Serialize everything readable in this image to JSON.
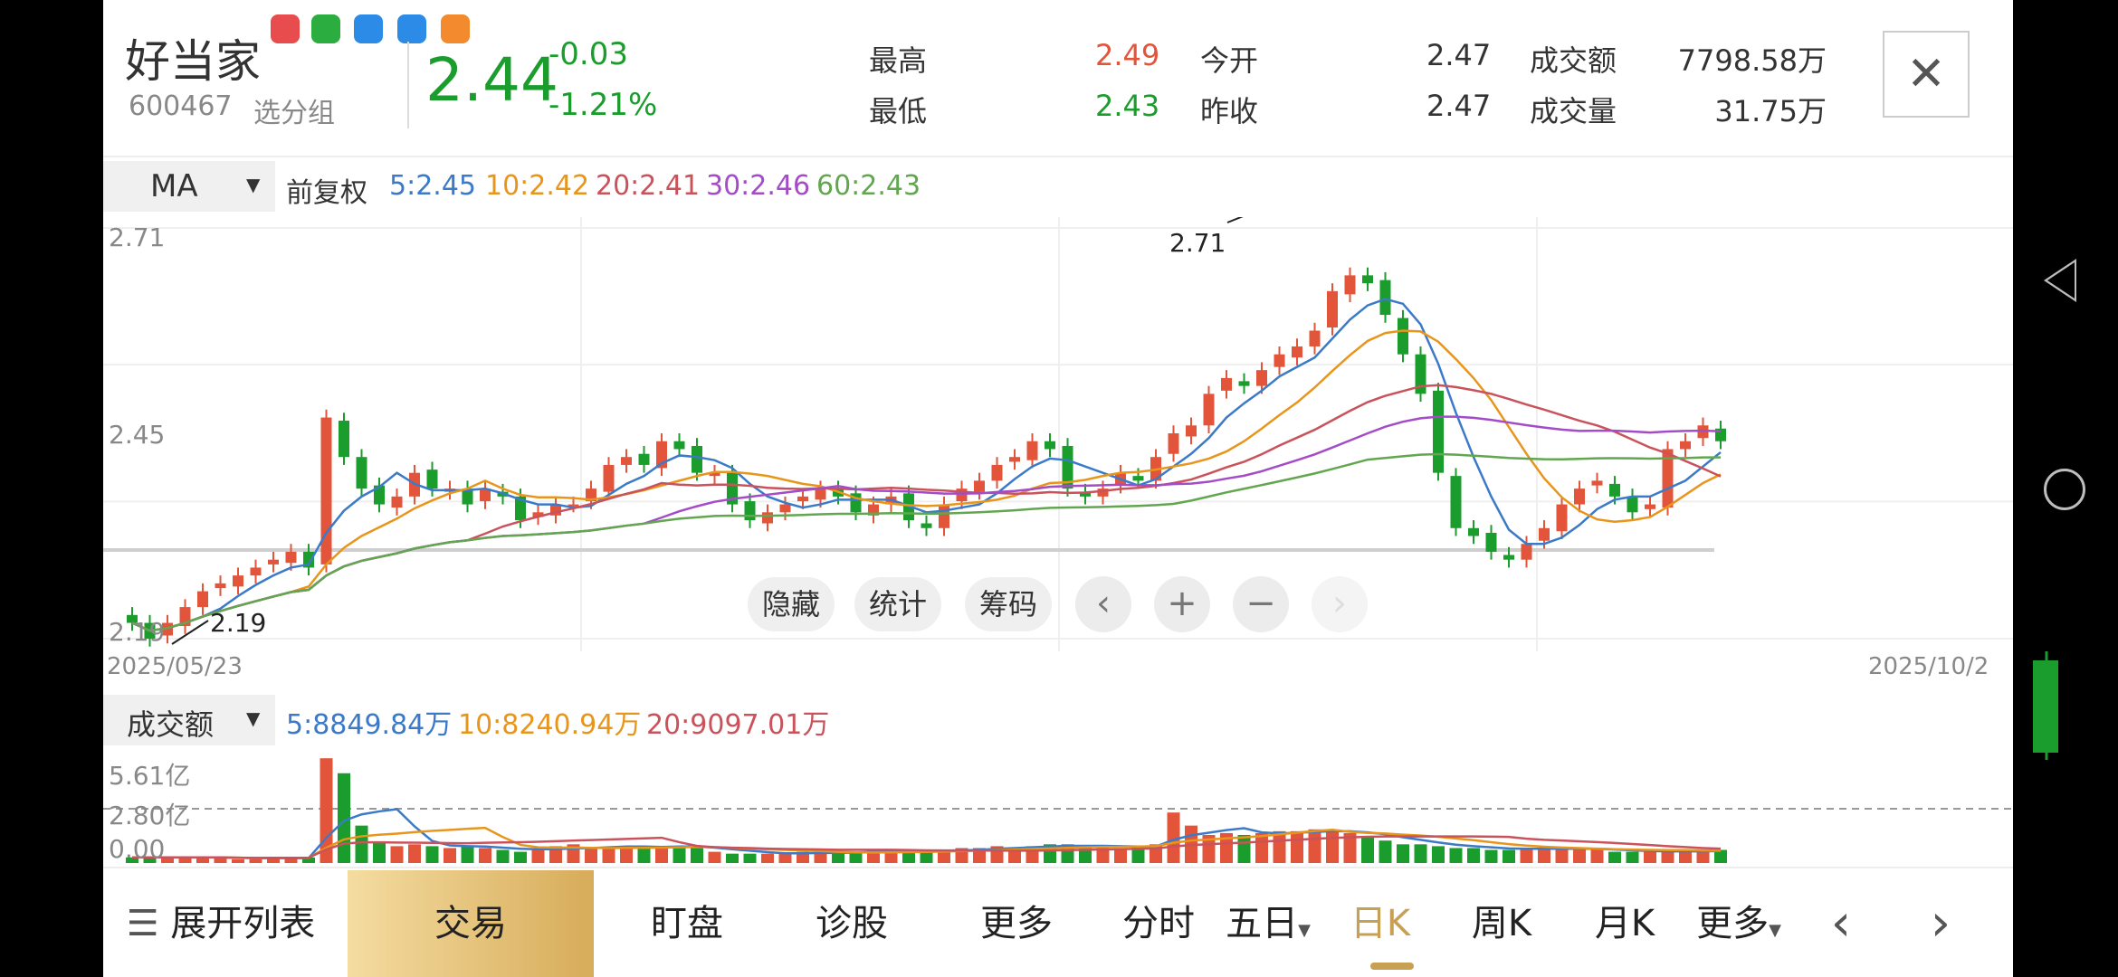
{
  "header": {
    "name": "好当家",
    "code": "600467",
    "group": "选分组",
    "price": "2.44",
    "change": "-0.03",
    "change_pct": "-1.21%",
    "high_label": "最高",
    "high": "2.49",
    "low_label": "最低",
    "low": "2.43",
    "open_label": "今开",
    "open": "2.47",
    "prev_close_label": "昨收",
    "prev_close": "2.47",
    "amount_label": "成交额",
    "amount": "7798.58万",
    "volume_label": "成交量",
    "volume": "31.75万",
    "close_symbol": "✕"
  },
  "indicator": {
    "type": "MA",
    "adjust": "前复权",
    "ma5": "5:2.45",
    "ma10": "10:2.42",
    "ma20": "20:2.41",
    "ma30": "30:2.46",
    "ma60": "60:2.43"
  },
  "chart": {
    "y_top": "2.71",
    "y_mid": "2.45",
    "y_bottom": "2.19",
    "max_annot": "2.71",
    "min_annot": "2.19",
    "date_start": "2025/05/23",
    "date_end": "2025/10/2",
    "buttons": {
      "hide": "隐藏",
      "stats": "统计",
      "chips": "筹码"
    },
    "nav": {
      "prev": "‹",
      "zoom_in": "+",
      "zoom_out": "−",
      "next": "›"
    }
  },
  "volume_panel": {
    "type": "成交额",
    "ma5": "5:8849.84万",
    "ma10": "10:8240.94万",
    "ma20": "20:9097.01万",
    "y_top": "5.61亿",
    "y_mid": "2.80亿",
    "y_bottom": "0.00"
  },
  "tabs": {
    "expand": "展开列表",
    "trade": "交易",
    "watch": "盯盘",
    "diagnose": "诊股",
    "more1": "更多",
    "intraday": "分时",
    "five_day": "五日",
    "daily": "日K",
    "weekly": "周K",
    "monthly": "月K",
    "more2": "更多",
    "left": "‹",
    "right": "›"
  },
  "colors": {
    "up": "#e2553b",
    "down": "#1a9d2c",
    "ma5": "#3b7ac9",
    "ma10": "#e8951c",
    "ma20": "#c9525b",
    "ma30": "#a44cc7",
    "ma60": "#62a650",
    "trade_tab": "#e6c16e"
  },
  "chart_data": {
    "type": "candlestick",
    "date_range": [
      "2025/05/23",
      "2025/10/2"
    ],
    "ylim": [
      2.19,
      2.71
    ],
    "close": [
      2.21,
      2.19,
      2.21,
      2.23,
      2.25,
      2.26,
      2.27,
      2.28,
      2.29,
      2.3,
      2.28,
      2.47,
      2.42,
      2.38,
      2.36,
      2.37,
      2.4,
      2.38,
      2.38,
      2.36,
      2.38,
      2.37,
      2.34,
      2.35,
      2.36,
      2.36,
      2.38,
      2.41,
      2.42,
      2.41,
      2.44,
      2.43,
      2.4,
      2.4,
      2.36,
      2.34,
      2.35,
      2.36,
      2.37,
      2.38,
      2.37,
      2.35,
      2.36,
      2.37,
      2.34,
      2.33,
      2.36,
      2.38,
      2.39,
      2.41,
      2.42,
      2.44,
      2.43,
      2.38,
      2.37,
      2.38,
      2.4,
      2.39,
      2.42,
      2.45,
      2.46,
      2.5,
      2.52,
      2.51,
      2.53,
      2.55,
      2.56,
      2.58,
      2.63,
      2.65,
      2.64,
      2.6,
      2.55,
      2.5,
      2.4,
      2.33,
      2.32,
      2.3,
      2.29,
      2.31,
      2.33,
      2.36,
      2.38,
      2.39,
      2.37,
      2.35,
      2.36,
      2.43,
      2.44,
      2.46,
      2.44
    ]
  },
  "volume_chart_data": {
    "type": "bar",
    "ylim": [
      0,
      5.61
    ],
    "values": [
      0.3,
      0.3,
      0.3,
      0.3,
      0.3,
      0.3,
      0.2,
      0.2,
      0.3,
      0.3,
      0.3,
      5.6,
      4.8,
      2.0,
      1.1,
      0.9,
      1.0,
      0.9,
      0.8,
      0.9,
      0.8,
      0.7,
      0.6,
      0.7,
      0.9,
      1.0,
      0.8,
      0.8,
      0.9,
      0.9,
      0.9,
      0.9,
      0.8,
      0.6,
      0.5,
      0.5,
      0.5,
      0.5,
      0.6,
      0.6,
      0.5,
      0.6,
      0.7,
      0.7,
      0.6,
      0.6,
      0.7,
      0.8,
      0.8,
      0.9,
      0.8,
      0.9,
      1.0,
      1.0,
      0.9,
      0.8,
      0.8,
      0.9,
      1.0,
      2.7,
      2.0,
      1.5,
      1.6,
      1.5,
      1.6,
      1.7,
      1.7,
      1.8,
      1.7,
      1.6,
      1.4,
      1.2,
      1.0,
      1.0,
      0.9,
      0.8,
      0.8,
      0.7,
      0.7,
      0.8,
      0.8,
      0.8,
      0.7,
      0.7,
      0.6,
      0.6,
      0.6,
      0.6,
      0.7,
      0.6,
      0.7
    ]
  }
}
